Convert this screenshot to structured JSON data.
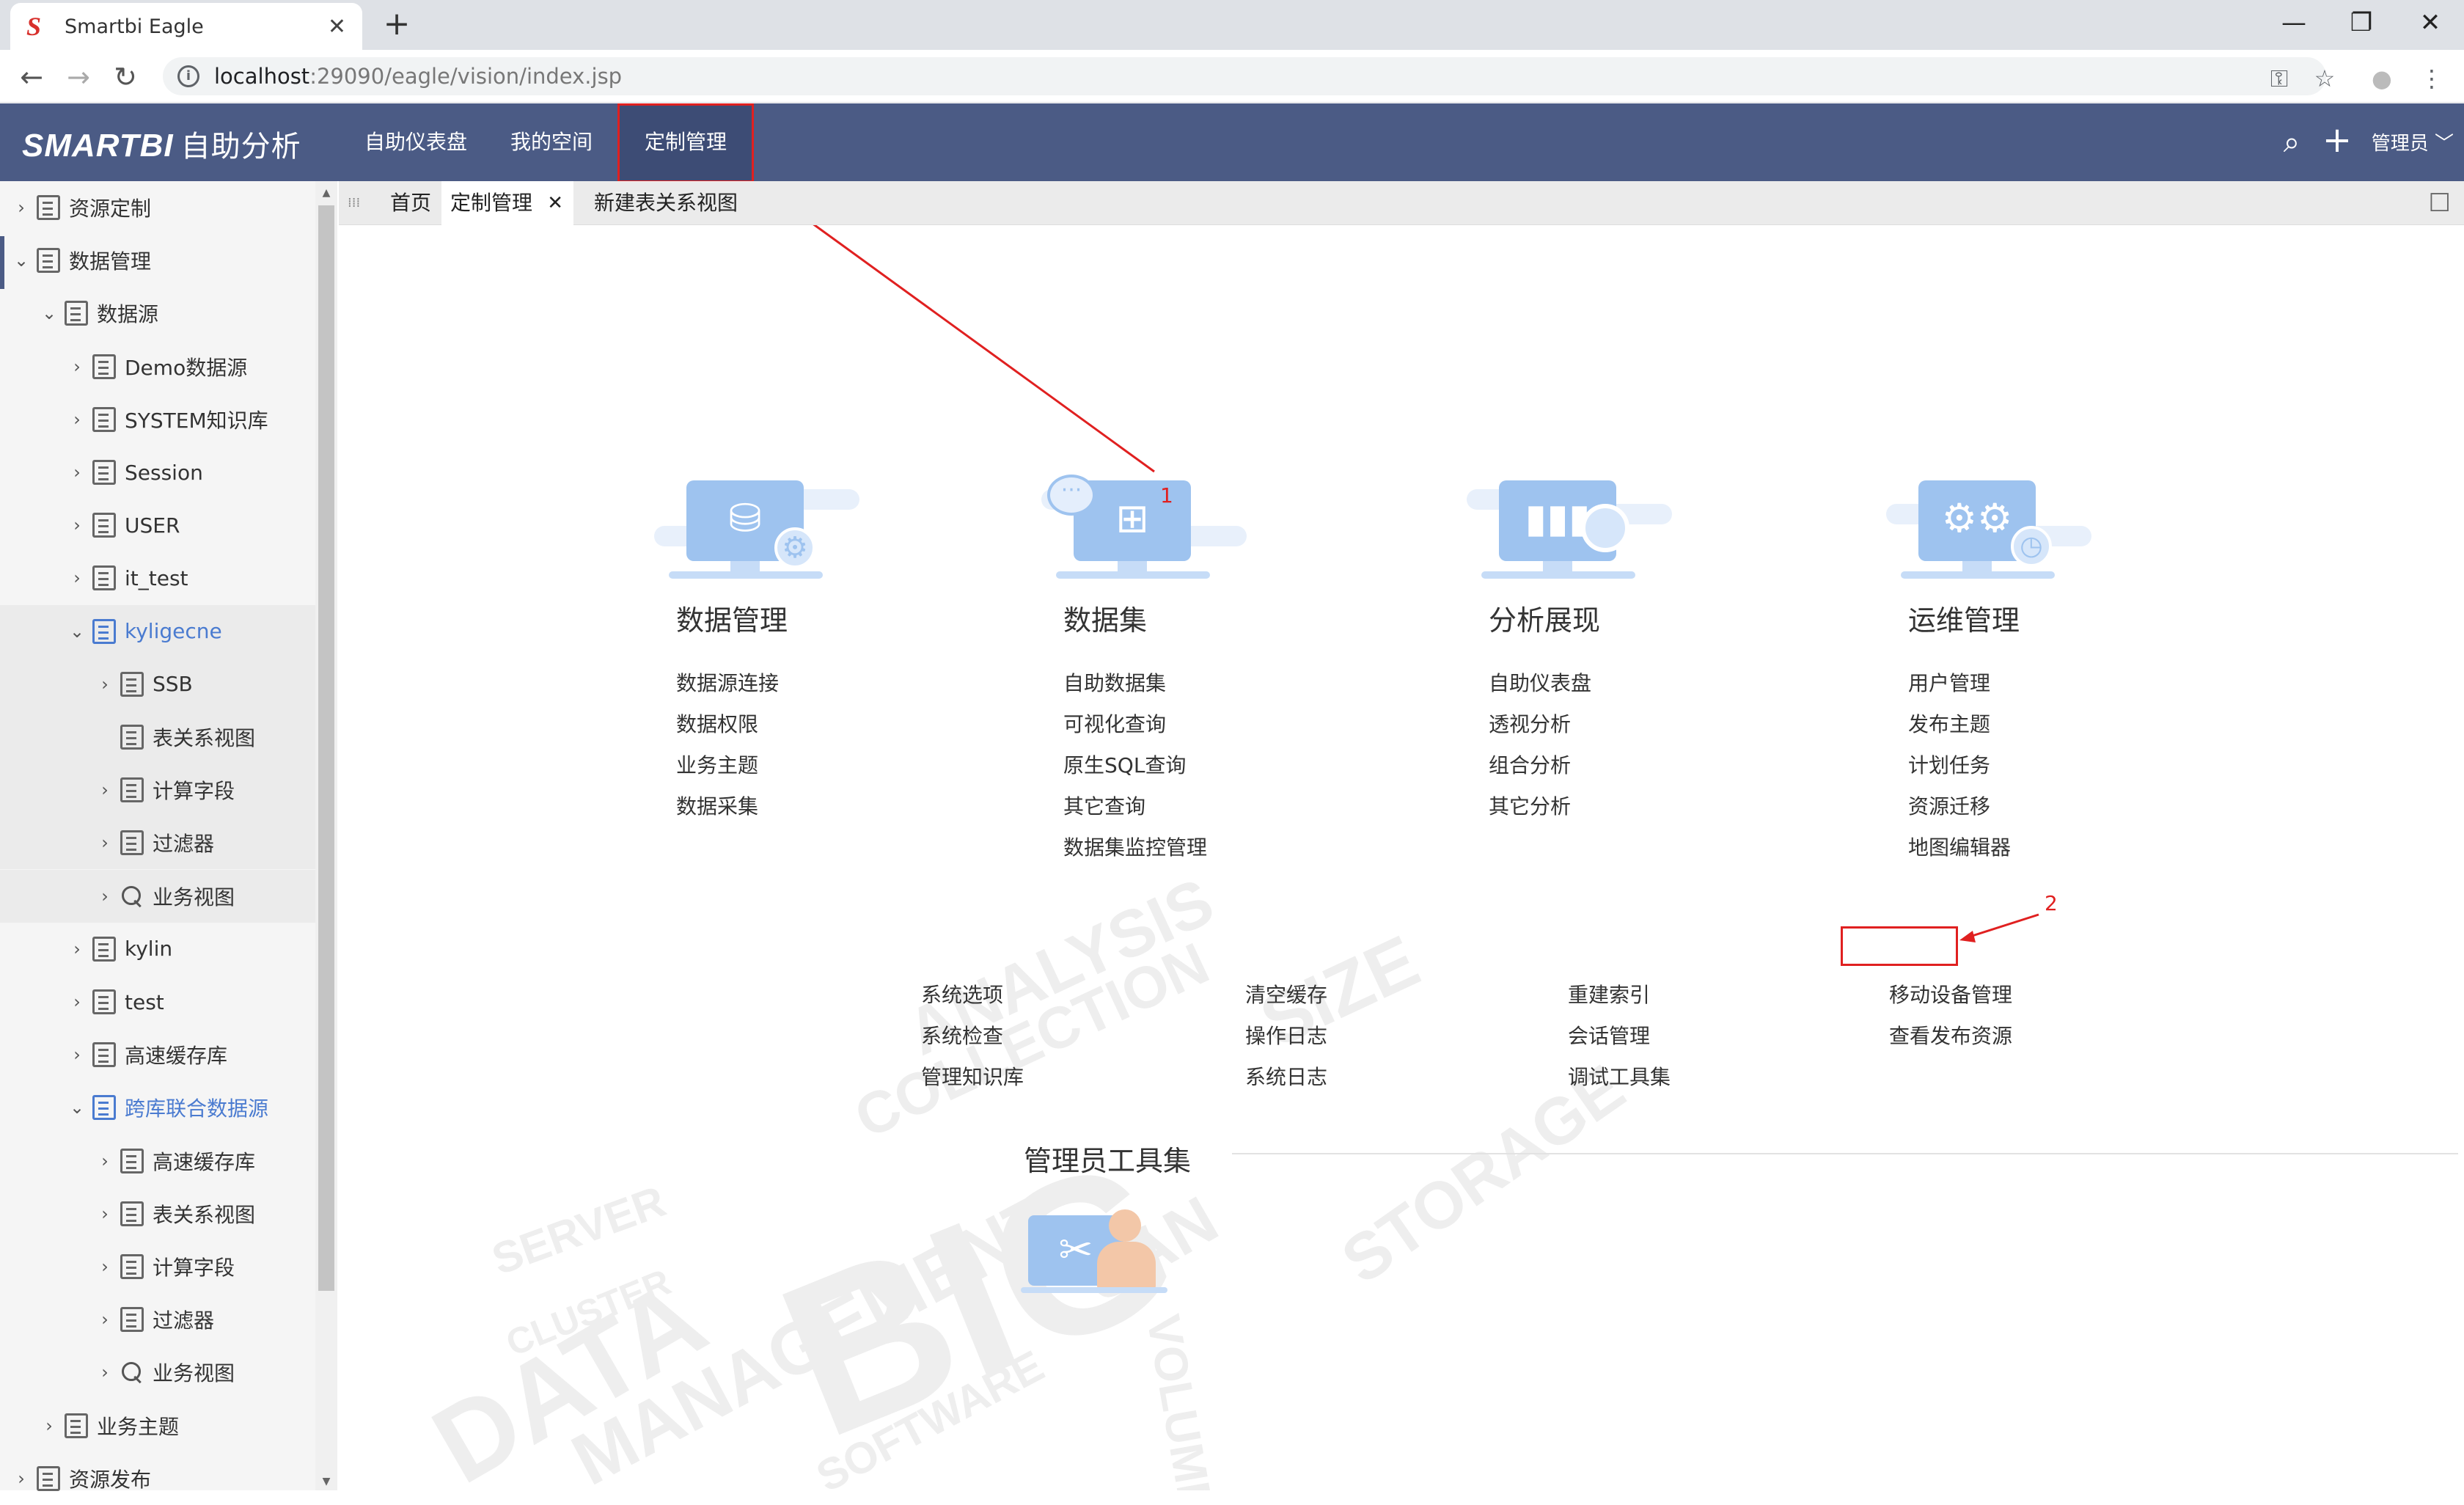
{
  "browser": {
    "tab_title": "Smartbi Eagle",
    "tab_favicon": "S",
    "url_host": "localhost",
    "url_rest": ":29090/eagle/vision/index.jsp",
    "close_glyph": "✕",
    "newtab_glyph": "+",
    "minimize_glyph": "—",
    "maximize_glyph": "❐",
    "winclose_glyph": "✕",
    "back_glyph": "←",
    "forward_glyph": "→",
    "reload_glyph": "↻",
    "info_glyph": "i",
    "key_glyph": "⚿",
    "star_glyph": "☆",
    "profile_glyph": "●",
    "menu_glyph": "⋮"
  },
  "header": {
    "logo": "SMARTBI",
    "logo_sub": "自助分析",
    "nav": [
      "自助仪表盘",
      "我的空间",
      "定制管理"
    ],
    "search_glyph": "⌕",
    "add_glyph": "+",
    "user": "管理员",
    "user_caret": "﹀"
  },
  "sidebar": {
    "items": [
      {
        "label": "资源定制",
        "arrow": "›"
      },
      {
        "label": "数据管理",
        "arrow": "⌄"
      },
      {
        "label": "数据源",
        "arrow": "⌄"
      },
      {
        "label": "Demo数据源",
        "arrow": "›"
      },
      {
        "label": "SYSTEM知识库",
        "arrow": "›"
      },
      {
        "label": "Session",
        "arrow": "›"
      },
      {
        "label": "USER",
        "arrow": "›"
      },
      {
        "label": "it_test",
        "arrow": "›"
      },
      {
        "label": "kyligecne",
        "arrow": "⌄"
      },
      {
        "label": "SSB",
        "arrow": "›"
      },
      {
        "label": "表关系视图",
        "arrow": ""
      },
      {
        "label": "计算字段",
        "arrow": "›"
      },
      {
        "label": "过滤器",
        "arrow": "›"
      },
      {
        "label": "业务视图",
        "arrow": "›"
      },
      {
        "label": "kylin",
        "arrow": "›"
      },
      {
        "label": "test",
        "arrow": "›"
      },
      {
        "label": "高速缓存库",
        "arrow": "›"
      },
      {
        "label": "跨库联合数据源",
        "arrow": "⌄"
      },
      {
        "label": "高速缓存库",
        "arrow": "›"
      },
      {
        "label": "表关系视图",
        "arrow": "›"
      },
      {
        "label": "计算字段",
        "arrow": "›"
      },
      {
        "label": "过滤器",
        "arrow": "›"
      },
      {
        "label": "业务视图",
        "arrow": "›"
      },
      {
        "label": "业务主题",
        "arrow": "›"
      },
      {
        "label": "资源发布",
        "arrow": "›"
      }
    ],
    "scroll_up": "▲",
    "scroll_down": "▼"
  },
  "page_tabs": {
    "handle": "⁞⁞⁞",
    "tabs": [
      "首页",
      "定制管理",
      "新建表关系视图"
    ],
    "close_glyph": "✕",
    "maximize_glyph": "☐"
  },
  "categories": [
    {
      "title": "数据管理",
      "icon": "database-settings-icon",
      "links": [
        "数据源连接",
        "数据权限",
        "业务主题",
        "数据采集"
      ]
    },
    {
      "title": "数据集",
      "icon": "dataset-tree-icon",
      "links": [
        "自助数据集",
        "可视化查询",
        "原生SQL查询",
        "其它查询",
        "数据集监控管理"
      ]
    },
    {
      "title": "分析展现",
      "icon": "chart-magnifier-icon",
      "links": [
        "自助仪表盘",
        "透视分析",
        "组合分析",
        "其它分析"
      ]
    },
    {
      "title": "运维管理",
      "icon": "gears-icon",
      "links": [
        "用户管理",
        "发布主题",
        "计划任务",
        "资源迁移",
        "地图编辑器"
      ]
    }
  ],
  "tools": {
    "title": "管理员工具集",
    "columns": [
      [
        "系统选项",
        "系统检查",
        "管理知识库"
      ],
      [
        "清空缓存",
        "操作日志",
        "系统日志"
      ],
      [
        "重建索引",
        "会话管理",
        "调试工具集"
      ],
      [
        "移动设备管理",
        "查看发布资源"
      ]
    ]
  },
  "annotations": {
    "step1": "1",
    "step2": "2"
  },
  "watermark": [
    "BIG",
    "DATA",
    "MANAGEMENT",
    "ANALYSIS",
    "SIZE",
    "STORAGE",
    "COLLECTION",
    "SOFTWARE",
    "SERVER",
    "VOLUME",
    "CLUSTER",
    "SAN"
  ],
  "colors": {
    "header": "#4b5b85",
    "active_nav": "#3d4c75",
    "tree_blue": "#4a7bd0",
    "annotation_red": "#e02020",
    "illustration_blue": "#9ec3ef"
  }
}
